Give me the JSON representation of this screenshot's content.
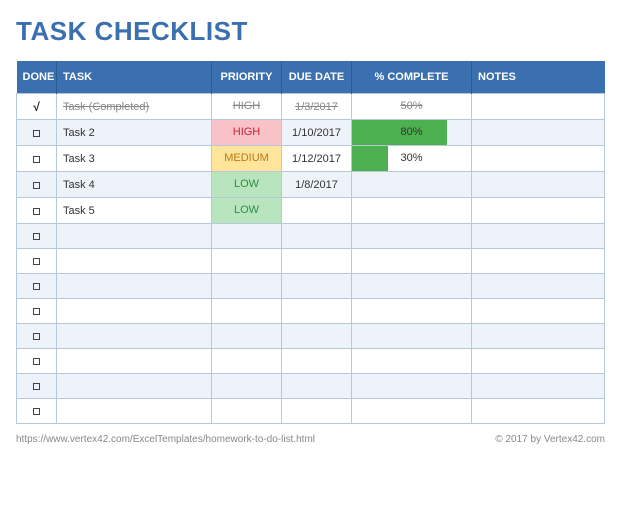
{
  "title": "TASK CHECKLIST",
  "columns": {
    "done": "DONE",
    "task": "TASK",
    "priority": "PRIORITY",
    "due": "DUE DATE",
    "pct": "% COMPLETE",
    "notes": "NOTES"
  },
  "rows": [
    {
      "done": true,
      "task": "Task (Completed)",
      "priority": "HIGH",
      "priority_class": "pri-high-done",
      "due": "1/3/2017",
      "pct": 50,
      "pct_label": "50%",
      "show_bar": false,
      "strike": true
    },
    {
      "done": false,
      "task": "Task 2",
      "priority": "HIGH",
      "priority_class": "pri-high",
      "due": "1/10/2017",
      "pct": 80,
      "pct_label": "80%",
      "show_bar": true,
      "strike": false
    },
    {
      "done": false,
      "task": "Task 3",
      "priority": "MEDIUM",
      "priority_class": "pri-med",
      "due": "1/12/2017",
      "pct": 30,
      "pct_label": "30%",
      "show_bar": true,
      "strike": false
    },
    {
      "done": false,
      "task": "Task 4",
      "priority": "LOW",
      "priority_class": "pri-low",
      "due": "1/8/2017",
      "pct": null,
      "pct_label": "",
      "show_bar": false,
      "strike": false
    },
    {
      "done": false,
      "task": "Task 5",
      "priority": "LOW",
      "priority_class": "pri-low",
      "due": "",
      "pct": null,
      "pct_label": "",
      "show_bar": false,
      "strike": false
    },
    {
      "done": false,
      "task": "",
      "priority": "",
      "priority_class": "",
      "due": "",
      "pct": null,
      "pct_label": "",
      "show_bar": false,
      "strike": false
    },
    {
      "done": false,
      "task": "",
      "priority": "",
      "priority_class": "",
      "due": "",
      "pct": null,
      "pct_label": "",
      "show_bar": false,
      "strike": false
    },
    {
      "done": false,
      "task": "",
      "priority": "",
      "priority_class": "",
      "due": "",
      "pct": null,
      "pct_label": "",
      "show_bar": false,
      "strike": false
    },
    {
      "done": false,
      "task": "",
      "priority": "",
      "priority_class": "",
      "due": "",
      "pct": null,
      "pct_label": "",
      "show_bar": false,
      "strike": false
    },
    {
      "done": false,
      "task": "",
      "priority": "",
      "priority_class": "",
      "due": "",
      "pct": null,
      "pct_label": "",
      "show_bar": false,
      "strike": false
    },
    {
      "done": false,
      "task": "",
      "priority": "",
      "priority_class": "",
      "due": "",
      "pct": null,
      "pct_label": "",
      "show_bar": false,
      "strike": false
    },
    {
      "done": false,
      "task": "",
      "priority": "",
      "priority_class": "",
      "due": "",
      "pct": null,
      "pct_label": "",
      "show_bar": false,
      "strike": false
    },
    {
      "done": false,
      "task": "",
      "priority": "",
      "priority_class": "",
      "due": "",
      "pct": null,
      "pct_label": "",
      "show_bar": false,
      "strike": false
    }
  ],
  "footer": {
    "left": "https://www.vertex42.com/ExcelTemplates/homework-to-do-list.html",
    "right": "© 2017 by Vertex42.com"
  }
}
